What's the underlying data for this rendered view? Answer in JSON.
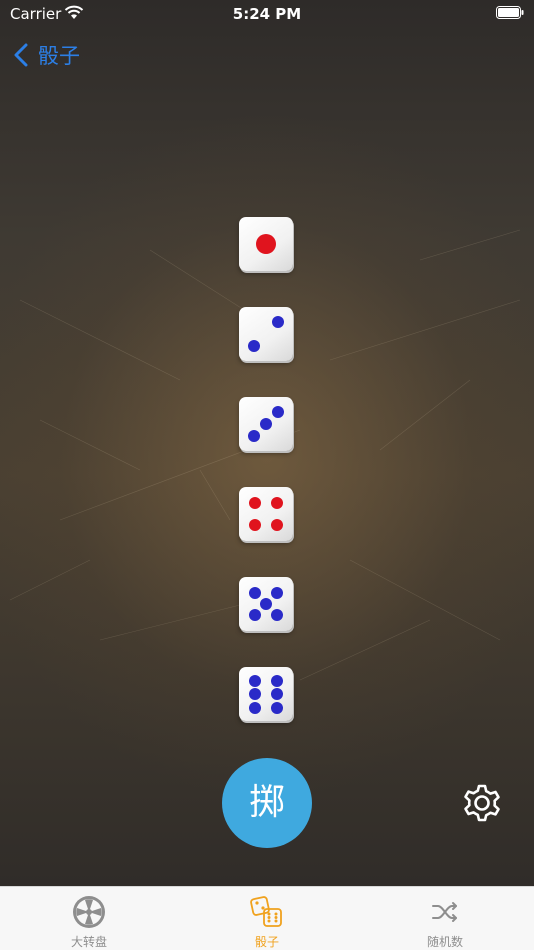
{
  "status_bar": {
    "carrier": "Carrier",
    "time": "5:24 PM"
  },
  "nav": {
    "back_label": "骰子"
  },
  "dice": [
    {
      "value": 1,
      "pip_color": "#e0141e"
    },
    {
      "value": 2,
      "pip_color": "#2a2ac8"
    },
    {
      "value": 3,
      "pip_color": "#2a2ac8"
    },
    {
      "value": 4,
      "pip_color": "#e0141e"
    },
    {
      "value": 5,
      "pip_color": "#2a2ac8"
    },
    {
      "value": 6,
      "pip_color": "#2a2ac8"
    }
  ],
  "roll_button": {
    "label": "掷",
    "color": "#3fa9df"
  },
  "settings": {
    "icon": "gear-icon"
  },
  "tab_bar": {
    "tabs": [
      {
        "label": "大转盘",
        "icon": "wheel-icon",
        "active": false
      },
      {
        "label": "骰子",
        "icon": "dice-icon",
        "active": true
      },
      {
        "label": "随机数",
        "icon": "shuffle-icon",
        "active": false
      }
    ],
    "active_color": "#f0a21e",
    "inactive_color": "#8e8e8e"
  }
}
